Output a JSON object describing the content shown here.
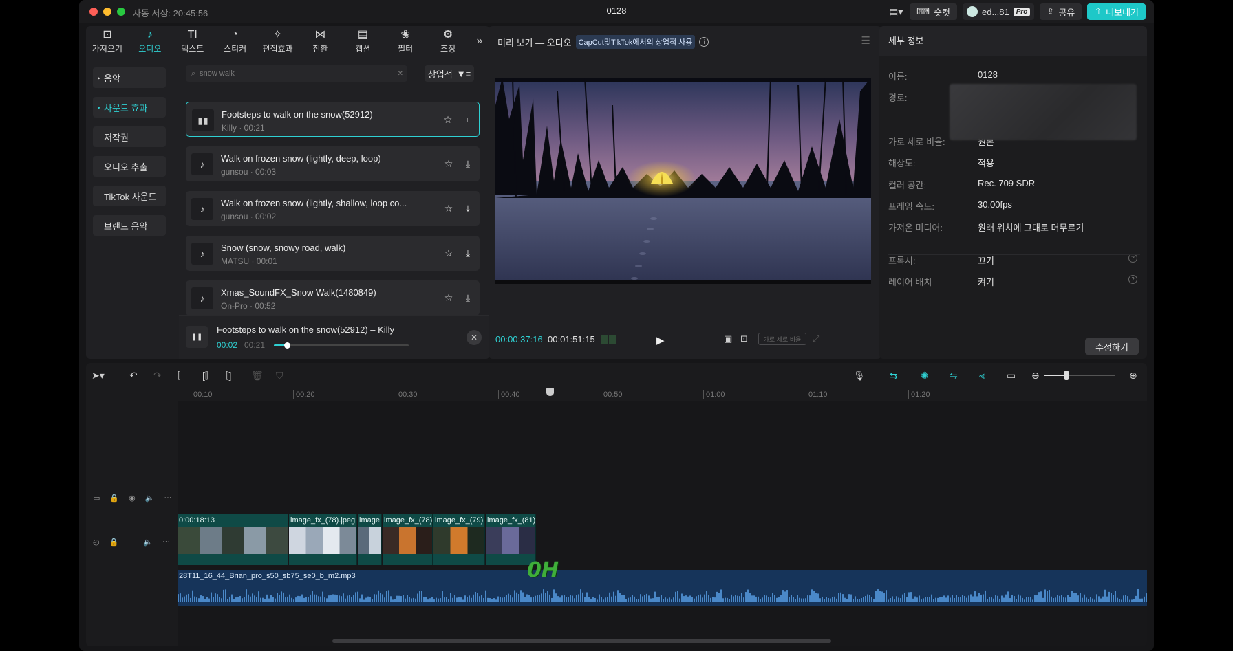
{
  "window": {
    "autosave": "자동 저장: 20:45:56",
    "title": "0128",
    "shortcut_label": "숏컷",
    "user_name": "ed...81",
    "pro_badge": "Pro",
    "share_label": "공유",
    "export_label": "내보내기"
  },
  "media_panel": {
    "tabs": [
      {
        "label": "가져오기",
        "icon": "import-icon"
      },
      {
        "label": "오디오",
        "icon": "audio-icon"
      },
      {
        "label": "텍스트",
        "icon": "text-icon"
      },
      {
        "label": "스티커",
        "icon": "sticker-icon"
      },
      {
        "label": "편집효과",
        "icon": "effects-icon"
      },
      {
        "label": "전환",
        "icon": "transition-icon"
      },
      {
        "label": "캡션",
        "icon": "caption-icon"
      },
      {
        "label": "필터",
        "icon": "filter-icon"
      },
      {
        "label": "조정",
        "icon": "adjust-icon"
      }
    ],
    "active_tab": "오디오",
    "categories": [
      "음악",
      "사운드 효과",
      "저작권",
      "오디오 추출",
      "TikTok 사운드",
      "브랜드 음악"
    ],
    "active_category": "사운드 효과",
    "search_value": "snow walk",
    "filter_label": "상업적",
    "results": [
      {
        "title": "Footsteps to walk on the snow(52912)",
        "author": "Killy",
        "duration": "00:21"
      },
      {
        "title": "Walk on frozen snow (lightly, deep, loop)",
        "author": "gunsou",
        "duration": "00:03"
      },
      {
        "title": "Walk on frozen snow (lightly, shallow, loop co...",
        "author": "gunsou",
        "duration": "00:02"
      },
      {
        "title": "Snow (snow, snowy road, walk)",
        "author": "MATSU",
        "duration": "00:01"
      },
      {
        "title": "Xmas_SoundFX_Snow Walk(1480849)",
        "author": "On-Pro",
        "duration": "00:52"
      }
    ],
    "selected_index": 0,
    "now_playing": {
      "title": "Footsteps to walk on the snow(52912) – Killy",
      "current": "00:02",
      "total": "00:21",
      "progress": 0.095
    }
  },
  "preview": {
    "title": "미리 보기 — 오디오",
    "badge": "CapCut및TikTok에서의 상업적 사용",
    "timecode": "00:00:37:16",
    "duration": "00:01:51:15",
    "ratio_label": "가로 세로 비율"
  },
  "details": {
    "header": "세부 정보",
    "rows": [
      {
        "key": "이름:",
        "value": "0128"
      },
      {
        "key": "경로:",
        "value": ""
      },
      {
        "key": "가로 세로 비율:",
        "value": "원본"
      },
      {
        "key": "해상도:",
        "value": "적용"
      },
      {
        "key": "컬러 공간:",
        "value": "Rec. 709 SDR"
      },
      {
        "key": "프레임 속도:",
        "value": "30.00fps"
      },
      {
        "key": "가져온 미디어:",
        "value": "원래 위치에 그대로 머무르기"
      },
      {
        "key": "프록시:",
        "value": "끄기"
      },
      {
        "key": "레이어 배치",
        "value": "켜기"
      }
    ],
    "edit_label": "수정하기"
  },
  "timeline": {
    "ruler": [
      "00:10",
      "00:20",
      "00:30",
      "00:40",
      "00:50",
      "01:00",
      "01:10",
      "01:20"
    ],
    "video_clips": [
      {
        "label": "0:00:18:13"
      },
      {
        "label": "image_fx_(78).jpeg"
      },
      {
        "label": "image"
      },
      {
        "label": "image_fx_(78)"
      },
      {
        "label": "image_fx_(79)"
      },
      {
        "label": "image_fx_(81)."
      }
    ],
    "audio_clip": "28T11_16_44_Brian_pro_s50_sb75_se0_b_m2.mp3",
    "overlay_text": "0H"
  },
  "colors": {
    "accent": "#2fd0d2",
    "export": "#1ec8c8",
    "video_clip": "#0f4a46",
    "audio_clip": "#16345a",
    "waveform": "#4a88c8"
  }
}
